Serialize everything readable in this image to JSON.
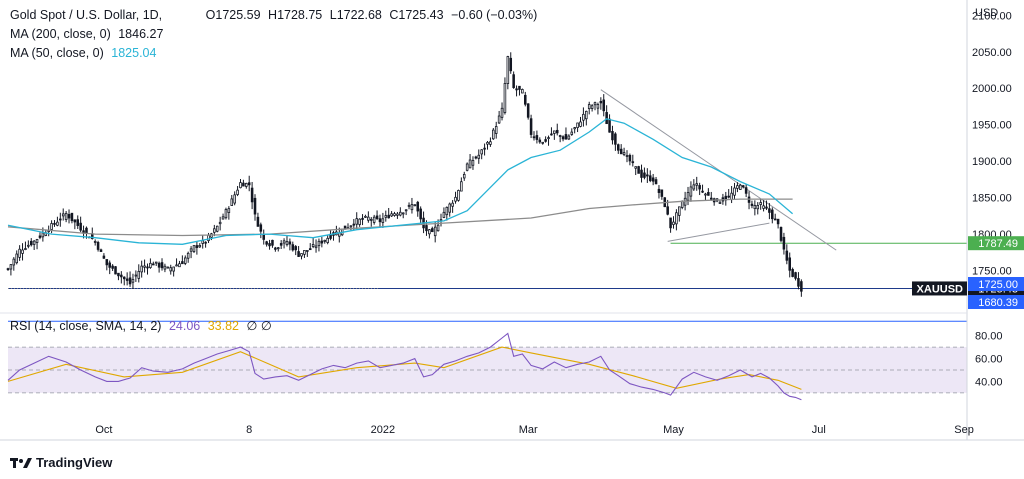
{
  "header": {
    "symbol": "Gold Spot / U.S. Dollar, 1D,",
    "o": "O1725.59",
    "h": "H1728.75",
    "l": "L1722.68",
    "c": "C1725.43",
    "chg": "−0.60 (−0.03%)",
    "ma200_label": "MA (200, close, 0)",
    "ma200_val": "1846.27",
    "ma50_label": "MA (50, close, 0)",
    "ma50_val": "1825.04"
  },
  "rsi_header": {
    "label": "RSI (14, close, SMA, 14, 2)",
    "rsi_val": "24.06",
    "sma_val": "33.82",
    "ext": "∅ ∅"
  },
  "branding": {
    "name": "TradingView"
  },
  "colors": {
    "ma50": "#2ab4d6",
    "ma200": "#8c8c8c",
    "price_tag": "#131722",
    "line_1725": "#2962ff",
    "line_1787": "#4caf50",
    "rsi": "#7e57c2",
    "rsi_sma": "#e0a800",
    "rsi_band": "#ede7f6"
  },
  "chart_data": {
    "type": "candlestick",
    "currency": "USD",
    "price_axis": {
      "ylim": [
        1700,
        2110
      ],
      "ticks": [
        1750,
        1800,
        1850,
        1900,
        1950,
        2000,
        2050,
        2100
      ]
    },
    "rsi_axis": {
      "ylim": [
        15,
        85
      ],
      "ticks": [
        40,
        60,
        80
      ],
      "band": [
        30,
        70
      ]
    },
    "x_ticks": [
      "Oct",
      "8",
      "2022",
      "Mar",
      "May",
      "Jul",
      "Sep"
    ],
    "x_tick_days": [
      33,
      83,
      129,
      179,
      229,
      279,
      329
    ],
    "price_labels": [
      {
        "text": "1787.49",
        "value": 1787.49,
        "color": "#4caf50"
      },
      {
        "text": "1725.43",
        "value": 1725.43,
        "color": "#131722",
        "symbol": "XAUUSD",
        "countdown": "15:50:27"
      },
      {
        "text": "1725.00",
        "value": 1725.0,
        "color": "#2962ff"
      },
      {
        "text": "1680.39",
        "value": 1680.39,
        "color": "#2962ff"
      }
    ],
    "horizontal_lines": [
      {
        "value": 1725.43,
        "color": "#1e3a8a",
        "from_day": 0
      },
      {
        "value": 1787.49,
        "color": "#4caf50",
        "from_day": 228
      },
      {
        "value": 1680.39,
        "color": "#2962ff",
        "from_day": 0
      }
    ],
    "trendlines": [
      {
        "from": [
          204,
          1998
        ],
        "to": [
          285,
          1778
        ]
      },
      {
        "from": [
          227,
          1790
        ],
        "to": [
          262,
          1815
        ]
      }
    ],
    "price_path": [
      [
        0,
        1752
      ],
      [
        4,
        1778
      ],
      [
        9,
        1790
      ],
      [
        14,
        1808
      ],
      [
        20,
        1828
      ],
      [
        25,
        1808
      ],
      [
        30,
        1790
      ],
      [
        34,
        1758
      ],
      [
        38,
        1745
      ],
      [
        42,
        1732
      ],
      [
        46,
        1755
      ],
      [
        50,
        1760
      ],
      [
        55,
        1752
      ],
      [
        60,
        1762
      ],
      [
        64,
        1782
      ],
      [
        68,
        1790
      ],
      [
        72,
        1810
      ],
      [
        76,
        1838
      ],
      [
        80,
        1870
      ],
      [
        83,
        1868
      ],
      [
        85,
        1825
      ],
      [
        88,
        1792
      ],
      [
        92,
        1782
      ],
      [
        96,
        1790
      ],
      [
        100,
        1772
      ],
      [
        104,
        1780
      ],
      [
        108,
        1790
      ],
      [
        112,
        1800
      ],
      [
        116,
        1808
      ],
      [
        120,
        1818
      ],
      [
        124,
        1822
      ],
      [
        128,
        1818
      ],
      [
        132,
        1828
      ],
      [
        136,
        1832
      ],
      [
        140,
        1842
      ],
      [
        143,
        1808
      ],
      [
        146,
        1800
      ],
      [
        150,
        1830
      ],
      [
        154,
        1850
      ],
      [
        158,
        1895
      ],
      [
        162,
        1908
      ],
      [
        166,
        1930
      ],
      [
        170,
        1970
      ],
      [
        172,
        2042
      ],
      [
        174,
        2000
      ],
      [
        177,
        1995
      ],
      [
        180,
        1938
      ],
      [
        184,
        1925
      ],
      [
        188,
        1940
      ],
      [
        192,
        1930
      ],
      [
        196,
        1950
      ],
      [
        200,
        1975
      ],
      [
        204,
        1980
      ],
      [
        207,
        1940
      ],
      [
        210,
        1918
      ],
      [
        214,
        1900
      ],
      [
        218,
        1880
      ],
      [
        222,
        1875
      ],
      [
        226,
        1840
      ],
      [
        228,
        1810
      ],
      [
        232,
        1842
      ],
      [
        236,
        1870
      ],
      [
        240,
        1855
      ],
      [
        244,
        1845
      ],
      [
        248,
        1850
      ],
      [
        252,
        1870
      ],
      [
        256,
        1838
      ],
      [
        259,
        1840
      ],
      [
        262,
        1830
      ],
      [
        265,
        1812
      ],
      [
        267,
        1776
      ],
      [
        269,
        1750
      ],
      [
        271,
        1738
      ],
      [
        273,
        1725
      ]
    ],
    "ma50_path": [
      [
        0,
        1812
      ],
      [
        15,
        1800
      ],
      [
        30,
        1795
      ],
      [
        45,
        1788
      ],
      [
        60,
        1786
      ],
      [
        75,
        1798
      ],
      [
        90,
        1800
      ],
      [
        105,
        1795
      ],
      [
        120,
        1806
      ],
      [
        135,
        1812
      ],
      [
        150,
        1818
      ],
      [
        158,
        1832
      ],
      [
        165,
        1860
      ],
      [
        172,
        1888
      ],
      [
        180,
        1905
      ],
      [
        190,
        1915
      ],
      [
        200,
        1940
      ],
      [
        206,
        1958
      ],
      [
        212,
        1952
      ],
      [
        222,
        1930
      ],
      [
        232,
        1905
      ],
      [
        242,
        1892
      ],
      [
        252,
        1872
      ],
      [
        262,
        1855
      ],
      [
        270,
        1828
      ]
    ],
    "ma200_path": [
      [
        0,
        1810
      ],
      [
        30,
        1800
      ],
      [
        60,
        1798
      ],
      [
        90,
        1800
      ],
      [
        120,
        1808
      ],
      [
        150,
        1815
      ],
      [
        180,
        1822
      ],
      [
        200,
        1835
      ],
      [
        215,
        1840
      ],
      [
        232,
        1845
      ],
      [
        252,
        1848
      ],
      [
        270,
        1848
      ]
    ],
    "rsi_path": [
      [
        0,
        41
      ],
      [
        4,
        50
      ],
      [
        9,
        56
      ],
      [
        14,
        62
      ],
      [
        20,
        57
      ],
      [
        25,
        50
      ],
      [
        30,
        44
      ],
      [
        34,
        40
      ],
      [
        38,
        40
      ],
      [
        42,
        43
      ],
      [
        46,
        52
      ],
      [
        50,
        49
      ],
      [
        55,
        48
      ],
      [
        60,
        51
      ],
      [
        64,
        56
      ],
      [
        68,
        60
      ],
      [
        72,
        64
      ],
      [
        76,
        67
      ],
      [
        80,
        70
      ],
      [
        83,
        66
      ],
      [
        85,
        47
      ],
      [
        88,
        42
      ],
      [
        92,
        44
      ],
      [
        96,
        45
      ],
      [
        100,
        41
      ],
      [
        104,
        46
      ],
      [
        108,
        51
      ],
      [
        112,
        54
      ],
      [
        116,
        52
      ],
      [
        120,
        56
      ],
      [
        124,
        58
      ],
      [
        128,
        52
      ],
      [
        132,
        54
      ],
      [
        136,
        56
      ],
      [
        140,
        60
      ],
      [
        143,
        44
      ],
      [
        146,
        46
      ],
      [
        150,
        55
      ],
      [
        154,
        58
      ],
      [
        158,
        62
      ],
      [
        162,
        65
      ],
      [
        166,
        70
      ],
      [
        170,
        78
      ],
      [
        172,
        82
      ],
      [
        174,
        62
      ],
      [
        177,
        64
      ],
      [
        180,
        54
      ],
      [
        184,
        51
      ],
      [
        188,
        57
      ],
      [
        192,
        52
      ],
      [
        196,
        55
      ],
      [
        200,
        57
      ],
      [
        204,
        62
      ],
      [
        207,
        50
      ],
      [
        210,
        45
      ],
      [
        214,
        38
      ],
      [
        218,
        35
      ],
      [
        222,
        33
      ],
      [
        226,
        30
      ],
      [
        228,
        28
      ],
      [
        232,
        42
      ],
      [
        236,
        48
      ],
      [
        240,
        44
      ],
      [
        244,
        41
      ],
      [
        248,
        45
      ],
      [
        252,
        50
      ],
      [
        256,
        44
      ],
      [
        259,
        47
      ],
      [
        262,
        43
      ],
      [
        265,
        36
      ],
      [
        267,
        30
      ],
      [
        269,
        27
      ],
      [
        271,
        26
      ],
      [
        273,
        24
      ]
    ],
    "rsi_sma_path": [
      [
        0,
        40
      ],
      [
        20,
        55
      ],
      [
        40,
        44
      ],
      [
        60,
        48
      ],
      [
        80,
        66
      ],
      [
        90,
        55
      ],
      [
        100,
        44
      ],
      [
        120,
        52
      ],
      [
        140,
        56
      ],
      [
        150,
        52
      ],
      [
        170,
        70
      ],
      [
        180,
        65
      ],
      [
        200,
        55
      ],
      [
        215,
        45
      ],
      [
        230,
        34
      ],
      [
        245,
        42
      ],
      [
        255,
        46
      ],
      [
        265,
        41
      ],
      [
        273,
        33
      ]
    ]
  }
}
